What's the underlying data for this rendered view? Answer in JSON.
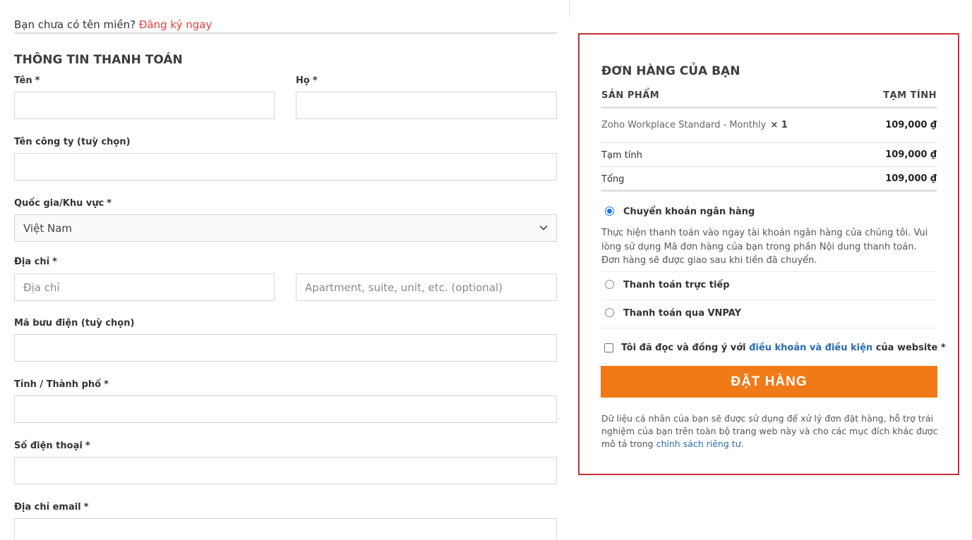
{
  "topline": {
    "question": "Bạn chưa có tên miền?",
    "register_link": "Đăng ký ngay"
  },
  "billing": {
    "title": "THÔNG TIN THANH TOÁN",
    "required_mark": "*",
    "first_name": {
      "label": "Tên",
      "value": ""
    },
    "last_name": {
      "label": "Họ",
      "value": ""
    },
    "company": {
      "label": "Tên công ty (tuỳ chọn)",
      "value": ""
    },
    "country": {
      "label": "Quốc gia/Khu vực",
      "value": "Việt Nam"
    },
    "address": {
      "label": "Địa chỉ",
      "placeholder1": "Địa chỉ",
      "placeholder2": "Apartment, suite, unit, etc. (optional)"
    },
    "postcode": {
      "label": "Mã bưu điện (tuỳ chọn)",
      "value": ""
    },
    "city": {
      "label": "Tỉnh / Thành phố",
      "value": ""
    },
    "phone": {
      "label": "Số điện thoại",
      "value": ""
    },
    "email": {
      "label": "Địa chỉ email",
      "value": ""
    }
  },
  "order": {
    "title": "ĐƠN HÀNG CỦA BẠN",
    "col_product": "SẢN PHẨM",
    "col_subtotal": "TẠM TÍNH",
    "product_name": "Zoho Workplace Standard - Monthly",
    "product_qty": "× 1",
    "product_price": "109,000 ₫",
    "subtotal_label": "Tạm tính",
    "subtotal_value": "109,000 ₫",
    "total_label": "Tổng",
    "total_value": "109,000 ₫",
    "payment_methods": [
      {
        "label": "Chuyển khoản ngân hàng",
        "selected": true
      },
      {
        "label": "Thanh toán trực tiếp",
        "selected": false
      },
      {
        "label": "Thanh toán qua VNPAY",
        "selected": false
      }
    ],
    "bank_desc": "Thực hiện thanh toán vào ngay tài khoản ngân hàng của chúng tôi. Vui lòng sử dụng Mã đơn hàng của bạn trong phần Nội dung thanh toán. Đơn hàng sẽ được giao sau khi tiền đã chuyển.",
    "terms_prefix": "Tôi đã đọc và đồng ý với",
    "terms_link": "điều khoản và điều kiện",
    "terms_suffix": "của website *",
    "place_order": "ĐẶT HÀNG",
    "privacy_text": "Dữ liệu cá nhân của bạn sẽ được sử dụng để xử lý đơn đặt hàng, hỗ trợ trải nghiệm của bạn trên toàn bộ trang web này và cho các mục đích khác được mô tả trong",
    "privacy_link": "chính sách riêng tư",
    "privacy_end": "."
  },
  "colors": {
    "accent_orange": "#f07a17",
    "border_red": "#c7303b",
    "link_red": "#e2403c",
    "link_blue": "#2a6bb0",
    "radio_blue": "#1a73e8"
  },
  "icons": {
    "select_chevron": "chevron-down-icon"
  }
}
